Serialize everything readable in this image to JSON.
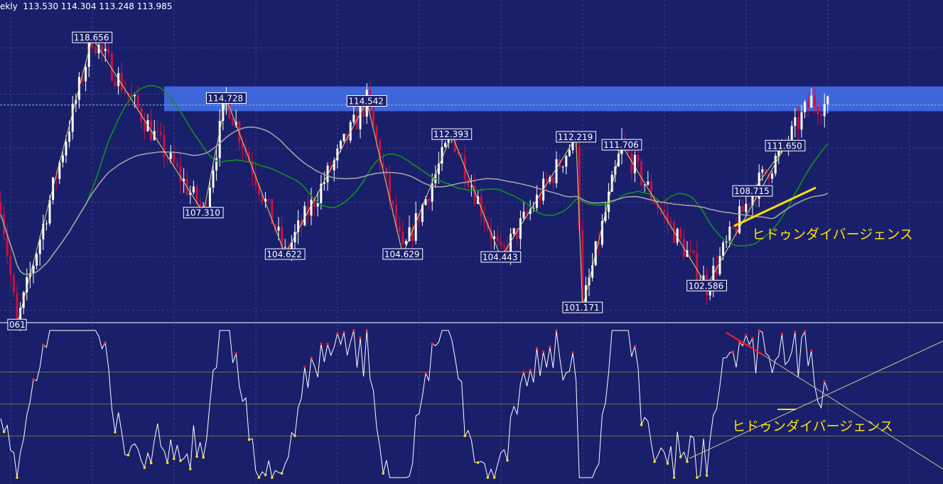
{
  "header": {
    "symbol_fragment": "ekly",
    "ohlc": "113.530 114.304 113.248 113.985"
  },
  "colors": {
    "background": "#1a1f6b",
    "grid": "#3a4080",
    "bull_candle": "#ffffff",
    "bear_candle": "#cc1040",
    "zigzag": "#d8d878",
    "ma_green": "#109020",
    "ma_gray": "#a0a0a8",
    "resistance_band": "#4169e1",
    "trend_line": "#ffe000",
    "oscillator": "#ffffff",
    "osc_peak": "#ff2020",
    "osc_trough": "#ffe000",
    "divergence_bear": "#ff2020"
  },
  "chart_data": {
    "type": "candlestick",
    "timeframe_fragment": "ekly",
    "ylim": [
      100.3,
      121.1
    ],
    "grid": true,
    "price_labels": [
      {
        "text": "118.656",
        "value": 118.656,
        "bar": 28
      },
      {
        "text": "114.728",
        "value": 114.728,
        "bar": 69
      },
      {
        "text": "107.310",
        "value": 107.31,
        "bar": 62
      },
      {
        "text": "114.542",
        "value": 114.542,
        "bar": 112
      },
      {
        "text": "104.622",
        "value": 104.622,
        "bar": 87
      },
      {
        "text": "112.393",
        "value": 112.393,
        "bar": 138
      },
      {
        "text": "104.629",
        "value": 104.629,
        "bar": 123
      },
      {
        "text": "112.219",
        "value": 112.219,
        "bar": 176
      },
      {
        "text": "111.706",
        "value": 111.706,
        "bar": 190
      },
      {
        "text": "104.443",
        "value": 104.443,
        "bar": 153
      },
      {
        "text": "101.171",
        "value": 101.171,
        "bar": 178
      },
      {
        "text": "102.586",
        "value": 102.586,
        "bar": 216
      },
      {
        "text": "108.715",
        "value": 108.715,
        "bar": 230
      },
      {
        "text": "111.650",
        "value": 111.65,
        "bar": 240
      },
      {
        "text": "061",
        "value": 100.061,
        "bar": 5
      }
    ],
    "zigzag": [
      {
        "bar": 5,
        "value": 100.06
      },
      {
        "bar": 28,
        "value": 118.656
      },
      {
        "bar": 62,
        "value": 107.31
      },
      {
        "bar": 69,
        "value": 114.728
      },
      {
        "bar": 87,
        "value": 104.622
      },
      {
        "bar": 112,
        "value": 114.542
      },
      {
        "bar": 123,
        "value": 104.629
      },
      {
        "bar": 138,
        "value": 112.393
      },
      {
        "bar": 153,
        "value": 104.443
      },
      {
        "bar": 176,
        "value": 112.219
      },
      {
        "bar": 178,
        "value": 101.171
      },
      {
        "bar": 190,
        "value": 111.706
      },
      {
        "bar": 216,
        "value": 102.586
      },
      {
        "bar": 240,
        "value": 111.65
      },
      {
        "bar": 230,
        "value": 108.715
      }
    ],
    "resistance_zone": [
      113.9,
      115.5
    ],
    "bars": 254,
    "oscillator": {
      "range": [
        0,
        100
      ],
      "levels": [
        70,
        50,
        30
      ]
    },
    "annotations": {
      "price_divergence": "ヒドゥンダイバージェンス",
      "osc_divergence": "ヒドゥンダイバージェンス"
    }
  }
}
